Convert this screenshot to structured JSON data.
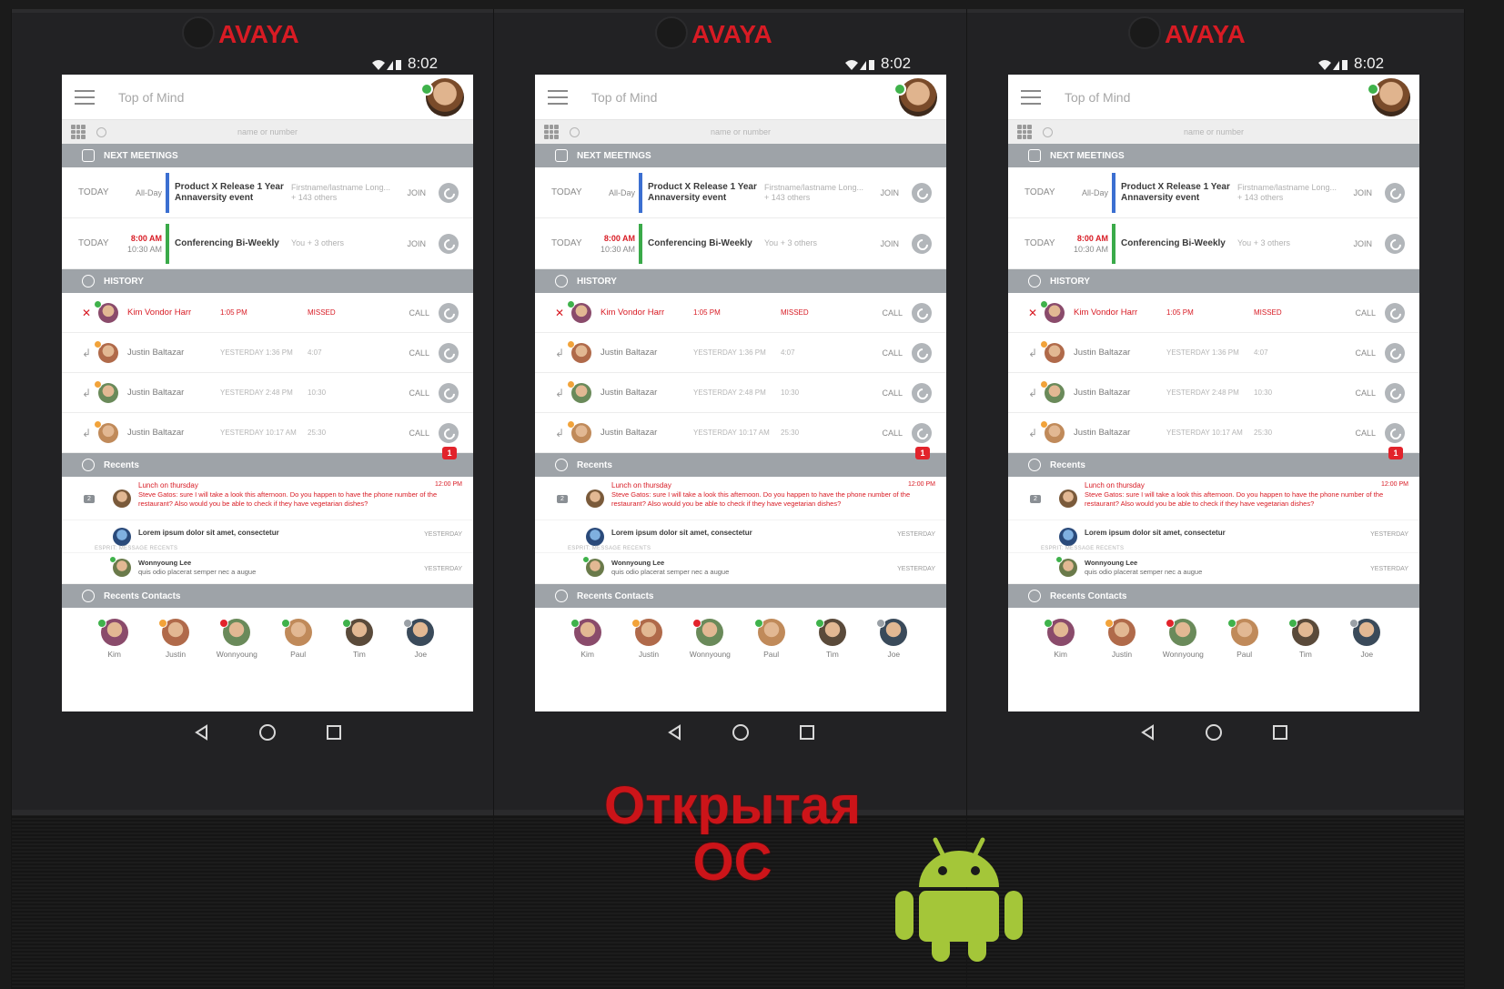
{
  "device": {
    "logo": "AVAYA",
    "clock": "8:02"
  },
  "app": {
    "title": "Top of Mind",
    "search_placeholder": "name or number",
    "sections": {
      "meetings": "NEXT MEETINGS",
      "history": "HISTORY",
      "recents": "Recents",
      "contacts": "Recents Contacts"
    },
    "meetings": [
      {
        "day": "TODAY",
        "time": "All-Day",
        "time2": "",
        "subject_line1": "Product X Release 1 Year",
        "subject_line2": "Annaversity event",
        "who_line1": "Firstname/lastname Long...",
        "who_line2": "+ 143 others",
        "action": "JOIN",
        "color": "#3b6fd1"
      },
      {
        "day": "TODAY",
        "time": "8:00 AM",
        "time2": "10:30 AM",
        "subject_line1": "Conferencing Bi-Weekly",
        "subject_line2": "",
        "who_line1": "You + 3 others",
        "who_line2": "",
        "action": "JOIN",
        "color": "#3aaa49"
      }
    ],
    "history": [
      {
        "dir": "✕",
        "name": "Kim Vondor Harr",
        "when": "1:05 PM",
        "duration": "MISSED",
        "action": "CALL",
        "missed": true,
        "status": "#3fb24b"
      },
      {
        "dir": "↲",
        "name": "Justin Baltazar",
        "when": "YESTERDAY 1:36 PM",
        "duration": "4:07",
        "action": "CALL",
        "missed": false,
        "status": "#f2a33a"
      },
      {
        "dir": "↲",
        "name": "Justin Baltazar",
        "when": "YESTERDAY 2:48 PM",
        "duration": "10:30",
        "action": "CALL",
        "missed": false,
        "status": "#f2a33a"
      },
      {
        "dir": "↲",
        "name": "Justin Baltazar",
        "when": "YESTERDAY 10:17 AM",
        "duration": "25:30",
        "action": "CALL",
        "missed": false,
        "status": "#f2a33a"
      }
    ],
    "history_badge": "1",
    "recents": [
      {
        "count": "2",
        "title": "Lunch on thursday",
        "text": "Steve Gatos: sure I will take a look this afternoon. Do you happen to have the phone number of the restaurant? Also would you be able to check if they have vegetarian dishes?",
        "time": "12:00 PM"
      },
      {
        "title": "Lorem ipsum dolor sit amet, consectetur",
        "time": "YESTERDAY"
      },
      {
        "caption": "ESPRIT: MESSAGE RECENTS",
        "name": "Wonnyoung Lee",
        "text": "quis odio placerat semper nec a augue",
        "time": "YESTERDAY"
      }
    ],
    "contacts": [
      {
        "name": "Kim",
        "status": "#3fb24b"
      },
      {
        "name": "Justin",
        "status": "#f2a33a"
      },
      {
        "name": "Wonnyoung",
        "status": "#e2232b"
      },
      {
        "name": "Paul",
        "status": "#3fb24b"
      },
      {
        "name": "Tim",
        "status": "#3fb24b"
      },
      {
        "name": "Joe",
        "status": "#9aa0a6"
      }
    ]
  },
  "caption": {
    "line1": "Открытая",
    "line2": "ОС"
  },
  "colors": {
    "brand_red": "#d81b24",
    "caption_red": "#cc1419",
    "android_green": "#a4c639",
    "section_grey": "#9ea3a8"
  }
}
